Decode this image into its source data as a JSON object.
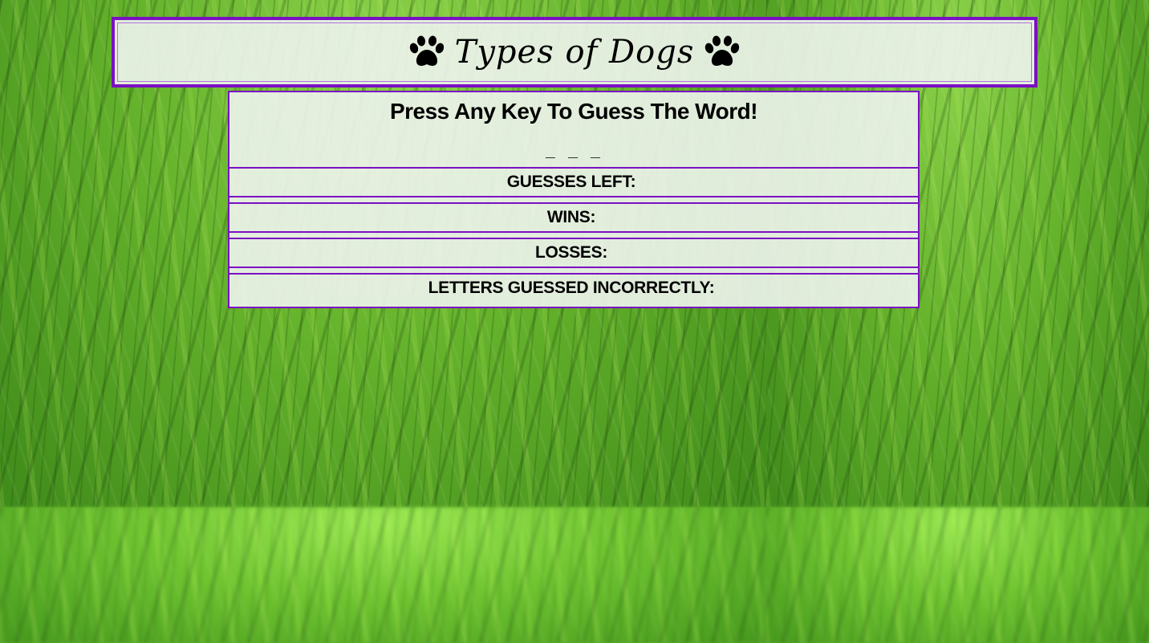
{
  "header": {
    "title": "Types of Dogs",
    "left_icon": "paw-print-icon",
    "right_icon": "paw-print-icon"
  },
  "game": {
    "prompt": "Press Any Key To Guess The Word!",
    "word_display": "_ _ _",
    "stats": {
      "guesses_left_label": "GUESSES LEFT:",
      "guesses_left_value": "",
      "wins_label": "WINS:",
      "wins_value": "",
      "losses_label": "LOSSES:",
      "losses_value": "",
      "incorrect_label": "LETTERS GUESSED INCORRECTLY:",
      "incorrect_value": ""
    }
  },
  "colors": {
    "border_accent": "#7b0fc4",
    "panel_background": "#ecf2ea",
    "text": "#000000",
    "background_grass": "#5aa82a"
  }
}
